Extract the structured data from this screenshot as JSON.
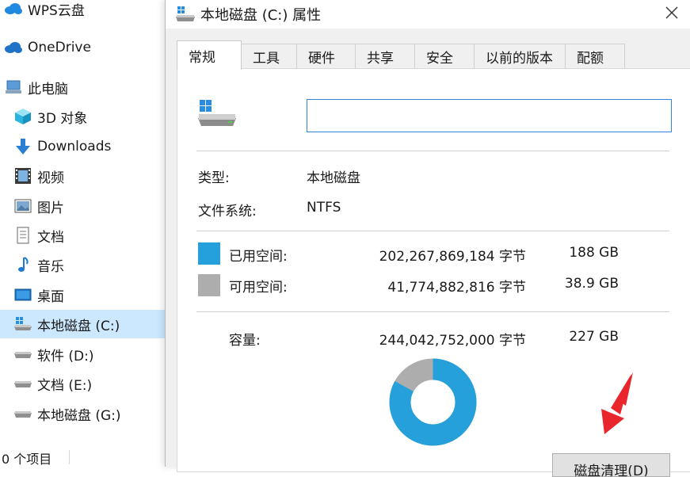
{
  "nav": {
    "items": [
      {
        "label": "WPS云盘",
        "icon": "cloud-icon"
      },
      {
        "label": "OneDrive",
        "icon": "cloud-icon"
      },
      {
        "label": "此电脑",
        "icon": "this-pc-icon"
      },
      {
        "label": "3D 对象",
        "icon": "3d-objects-icon"
      },
      {
        "label": "Downloads",
        "icon": "download-arrow-icon"
      },
      {
        "label": "视频",
        "icon": "video-icon"
      },
      {
        "label": "图片",
        "icon": "pictures-icon"
      },
      {
        "label": "文档",
        "icon": "document-icon"
      },
      {
        "label": "音乐",
        "icon": "music-note-icon"
      },
      {
        "label": "桌面",
        "icon": "desktop-icon"
      },
      {
        "label": "本地磁盘 (C:)",
        "icon": "drive-windows-icon"
      },
      {
        "label": "软件 (D:)",
        "icon": "drive-icon"
      },
      {
        "label": "文档 (E:)",
        "icon": "drive-icon"
      },
      {
        "label": "本地磁盘 (G:)",
        "icon": "drive-icon"
      }
    ],
    "status": "0 个项目"
  },
  "dialog": {
    "title": "本地磁盘 (C:) 属性",
    "tabs": [
      "常规",
      "工具",
      "硬件",
      "共享",
      "安全",
      "以前的版本",
      "配额"
    ],
    "active_tab": "常规",
    "volume_name": "",
    "type_label": "类型:",
    "type_value": "本地磁盘",
    "fs_label": "文件系统:",
    "fs_value": "NTFS",
    "used_label": "已用空间:",
    "used_bytes": "202,267,869,184 字节",
    "used_size": "188 GB",
    "free_label": "可用空间:",
    "free_bytes": "41,774,882,816 字节",
    "free_size": "38.9 GB",
    "capacity_label": "容量:",
    "capacity_bytes": "244,042,752,000 字节",
    "capacity_size": "227 GB",
    "cleanup_label": "磁盘清理(D)",
    "used_fraction": 0.8288,
    "colors": {
      "used": "#26a0da",
      "free": "#adadad",
      "accent": "#2f86d6",
      "selected_nav": "#cce8ff",
      "annotation_arrow": "#e8262b"
    }
  }
}
